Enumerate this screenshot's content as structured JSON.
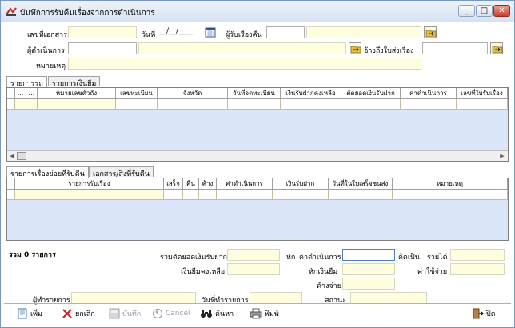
{
  "window": {
    "title": "บันทึกการรับคืนเรื่องจากการดำเนินการ",
    "min_glyph": "_",
    "max_glyph": "□",
    "close_glyph": "✕"
  },
  "header": {
    "doc_no_label": "เลขที่เอกสาร",
    "date_label": "วันที่",
    "date_value": "__/__/____",
    "receiver_label": "ผู้รับเรื่องคืน",
    "operator_label": "ผู้ดำเนินการ",
    "ref_label": "อ้างถึงใบส่งเรื่อง",
    "remark_label": "หมายเหตุ"
  },
  "tabs_top": [
    {
      "label": "รายการรถ"
    },
    {
      "label": "รายการเงินยืม"
    }
  ],
  "grid_top": {
    "columns": [
      "...",
      "...",
      "หมายเลขตัวถัง",
      "เลขทะเบียน",
      "จังหวัด",
      "วันที่จดทะเบียน",
      "เงินรับฝากคงเหลือ",
      "ตัดยอดเงินรับฝาก",
      "ค่าดำเนินการ",
      "เลขที่ใบรับเรื่อง"
    ]
  },
  "tabs_bottom": [
    {
      "label": "รายการเรื่องย่อยที่รับคืน"
    },
    {
      "label": "เอกสาร/สิ่งที่รับคืน"
    }
  ],
  "grid_bottom": {
    "columns": [
      "รายการรับเรื่อง",
      "เสร็จ",
      "คืน",
      "ค้าง",
      "ค่าดำเนินการ",
      "เงินรับฝาก",
      "วันที่ในใบเสร็จชนส่ง",
      "หมายเหตุ"
    ]
  },
  "summary": {
    "total_label": "รวม 0 รายการ",
    "total_deduct_label": "รวมตัดยอดเงินรับฝาก",
    "loan_balance_label": "เงินยืมคงเหลือ",
    "minus_label": "หัก",
    "op_fee_label": "ค่าดำเนินการ",
    "calc_as_label": "คิดเป็น",
    "income_label": "รายได้",
    "expense_label": "ค่าใช้จ่าย",
    "loan_deduct_label": "หักเงินยืม",
    "outstanding_label": "ค้างจ่าย",
    "recorder_label": "ผู้ทำรายการ",
    "record_date_label": "วันที่ทำรายการ",
    "status_label": "สถานะ"
  },
  "toolbar": {
    "add": "เพิ่ม",
    "cancel_doc": "ยกเลิก",
    "save": "บันทึก",
    "cancel": "Cancel",
    "search": "ค้นหา",
    "print": "พิมพ์",
    "close": "ปิด"
  },
  "colors": {
    "input_bg": "#ffffe0",
    "grid_bg": "#dbe6f8",
    "title_gradient_top": "#eef3fb"
  },
  "icons": [
    "app-icon",
    "calendar-icon",
    "lookup-icon",
    "add-icon",
    "delete-icon",
    "save-icon",
    "undo-icon",
    "binoculars-icon",
    "printer-icon",
    "exit-icon"
  ]
}
